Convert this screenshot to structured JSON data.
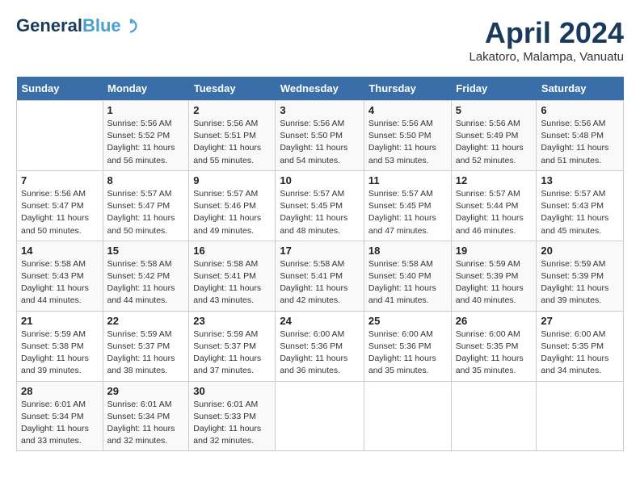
{
  "header": {
    "logo_line1": "General",
    "logo_line2": "Blue",
    "month_title": "April 2024",
    "subtitle": "Lakatoro, Malampa, Vanuatu"
  },
  "days_of_week": [
    "Sunday",
    "Monday",
    "Tuesday",
    "Wednesday",
    "Thursday",
    "Friday",
    "Saturday"
  ],
  "weeks": [
    [
      {
        "day": "",
        "info": ""
      },
      {
        "day": "1",
        "info": "Sunrise: 5:56 AM\nSunset: 5:52 PM\nDaylight: 11 hours\nand 56 minutes."
      },
      {
        "day": "2",
        "info": "Sunrise: 5:56 AM\nSunset: 5:51 PM\nDaylight: 11 hours\nand 55 minutes."
      },
      {
        "day": "3",
        "info": "Sunrise: 5:56 AM\nSunset: 5:50 PM\nDaylight: 11 hours\nand 54 minutes."
      },
      {
        "day": "4",
        "info": "Sunrise: 5:56 AM\nSunset: 5:50 PM\nDaylight: 11 hours\nand 53 minutes."
      },
      {
        "day": "5",
        "info": "Sunrise: 5:56 AM\nSunset: 5:49 PM\nDaylight: 11 hours\nand 52 minutes."
      },
      {
        "day": "6",
        "info": "Sunrise: 5:56 AM\nSunset: 5:48 PM\nDaylight: 11 hours\nand 51 minutes."
      }
    ],
    [
      {
        "day": "7",
        "info": "Sunrise: 5:56 AM\nSunset: 5:47 PM\nDaylight: 11 hours\nand 50 minutes."
      },
      {
        "day": "8",
        "info": "Sunrise: 5:57 AM\nSunset: 5:47 PM\nDaylight: 11 hours\nand 50 minutes."
      },
      {
        "day": "9",
        "info": "Sunrise: 5:57 AM\nSunset: 5:46 PM\nDaylight: 11 hours\nand 49 minutes."
      },
      {
        "day": "10",
        "info": "Sunrise: 5:57 AM\nSunset: 5:45 PM\nDaylight: 11 hours\nand 48 minutes."
      },
      {
        "day": "11",
        "info": "Sunrise: 5:57 AM\nSunset: 5:45 PM\nDaylight: 11 hours\nand 47 minutes."
      },
      {
        "day": "12",
        "info": "Sunrise: 5:57 AM\nSunset: 5:44 PM\nDaylight: 11 hours\nand 46 minutes."
      },
      {
        "day": "13",
        "info": "Sunrise: 5:57 AM\nSunset: 5:43 PM\nDaylight: 11 hours\nand 45 minutes."
      }
    ],
    [
      {
        "day": "14",
        "info": "Sunrise: 5:58 AM\nSunset: 5:43 PM\nDaylight: 11 hours\nand 44 minutes."
      },
      {
        "day": "15",
        "info": "Sunrise: 5:58 AM\nSunset: 5:42 PM\nDaylight: 11 hours\nand 44 minutes."
      },
      {
        "day": "16",
        "info": "Sunrise: 5:58 AM\nSunset: 5:41 PM\nDaylight: 11 hours\nand 43 minutes."
      },
      {
        "day": "17",
        "info": "Sunrise: 5:58 AM\nSunset: 5:41 PM\nDaylight: 11 hours\nand 42 minutes."
      },
      {
        "day": "18",
        "info": "Sunrise: 5:58 AM\nSunset: 5:40 PM\nDaylight: 11 hours\nand 41 minutes."
      },
      {
        "day": "19",
        "info": "Sunrise: 5:59 AM\nSunset: 5:39 PM\nDaylight: 11 hours\nand 40 minutes."
      },
      {
        "day": "20",
        "info": "Sunrise: 5:59 AM\nSunset: 5:39 PM\nDaylight: 11 hours\nand 39 minutes."
      }
    ],
    [
      {
        "day": "21",
        "info": "Sunrise: 5:59 AM\nSunset: 5:38 PM\nDaylight: 11 hours\nand 39 minutes."
      },
      {
        "day": "22",
        "info": "Sunrise: 5:59 AM\nSunset: 5:37 PM\nDaylight: 11 hours\nand 38 minutes."
      },
      {
        "day": "23",
        "info": "Sunrise: 5:59 AM\nSunset: 5:37 PM\nDaylight: 11 hours\nand 37 minutes."
      },
      {
        "day": "24",
        "info": "Sunrise: 6:00 AM\nSunset: 5:36 PM\nDaylight: 11 hours\nand 36 minutes."
      },
      {
        "day": "25",
        "info": "Sunrise: 6:00 AM\nSunset: 5:36 PM\nDaylight: 11 hours\nand 35 minutes."
      },
      {
        "day": "26",
        "info": "Sunrise: 6:00 AM\nSunset: 5:35 PM\nDaylight: 11 hours\nand 35 minutes."
      },
      {
        "day": "27",
        "info": "Sunrise: 6:00 AM\nSunset: 5:35 PM\nDaylight: 11 hours\nand 34 minutes."
      }
    ],
    [
      {
        "day": "28",
        "info": "Sunrise: 6:01 AM\nSunset: 5:34 PM\nDaylight: 11 hours\nand 33 minutes."
      },
      {
        "day": "29",
        "info": "Sunrise: 6:01 AM\nSunset: 5:34 PM\nDaylight: 11 hours\nand 32 minutes."
      },
      {
        "day": "30",
        "info": "Sunrise: 6:01 AM\nSunset: 5:33 PM\nDaylight: 11 hours\nand 32 minutes."
      },
      {
        "day": "",
        "info": ""
      },
      {
        "day": "",
        "info": ""
      },
      {
        "day": "",
        "info": ""
      },
      {
        "day": "",
        "info": ""
      }
    ]
  ]
}
